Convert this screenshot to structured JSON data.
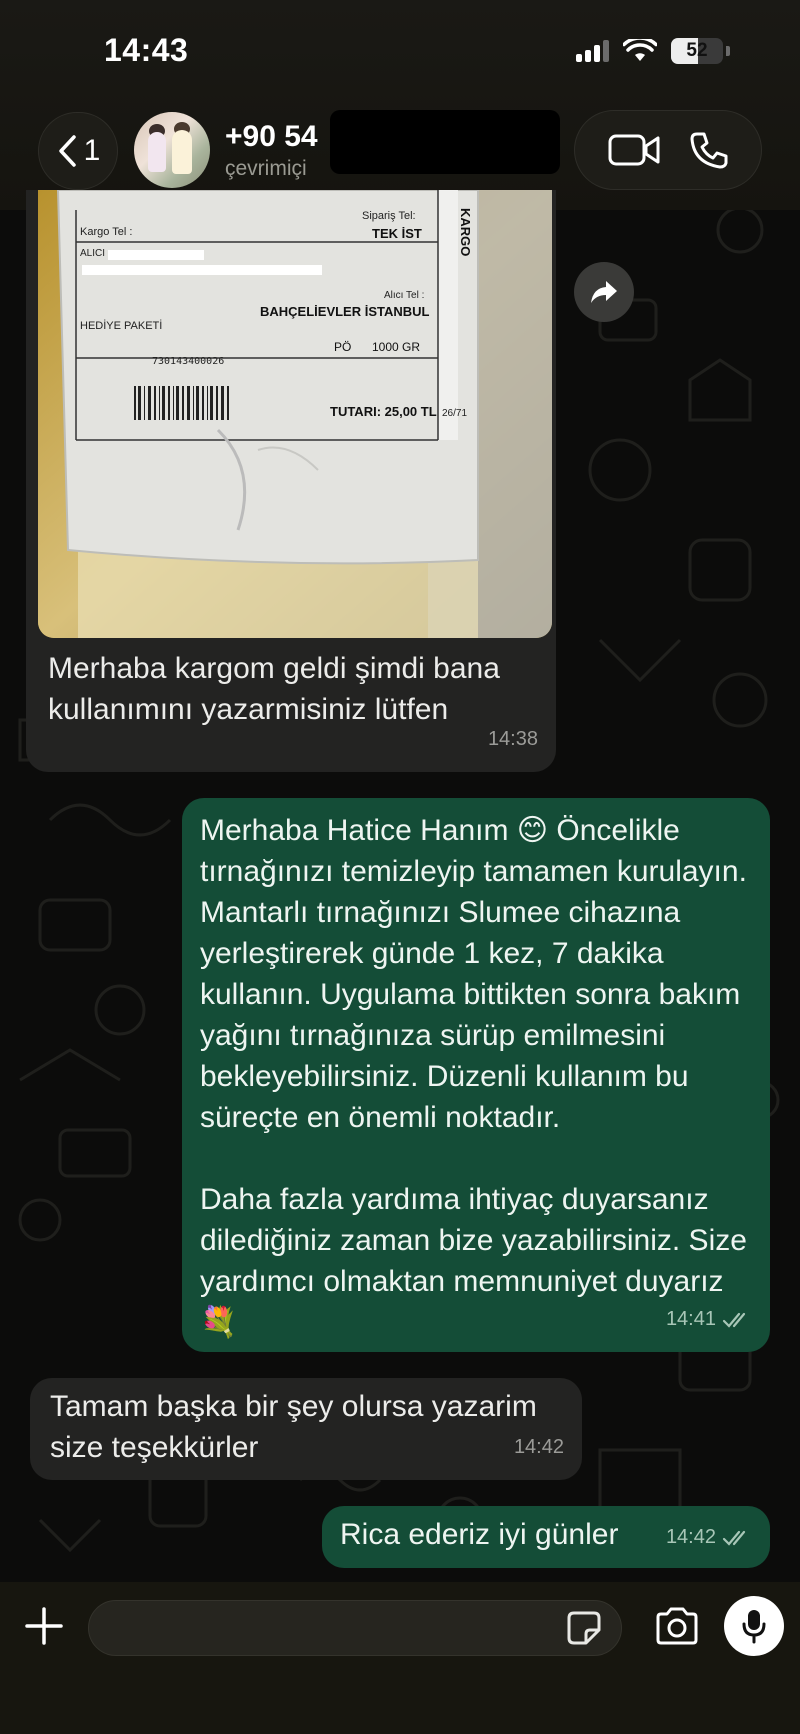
{
  "status_bar": {
    "time": "14:43",
    "battery": "52",
    "battery_level": 0.52
  },
  "header": {
    "back_count": "1",
    "contact_name": "+90 54",
    "contact_status": "çevrimiçi"
  },
  "image_message": {
    "label": {
      "cargo_phone": "Kargo Tel :",
      "order_phone": "Sipariş Tel:",
      "sender_code": "TEK İST",
      "receiver": "ALICI",
      "receiver_phone": "Alıcı Tel :",
      "address": "BAHÇELİEVLER İSTANBUL",
      "package_type": "HEDİYE PAKETİ",
      "weight_code": "PÖ",
      "weight": "1000 GR",
      "barcode": "730143400026",
      "total": "TUTARI: 25,00 TL",
      "side_code": "26/71",
      "brand_side": "KARGO"
    }
  },
  "messages": [
    {
      "direction": "incoming",
      "text": "Merhaba kargom geldi şimdi bana kullanımını yazarmisiniz lütfen",
      "time": "14:38"
    },
    {
      "direction": "outgoing",
      "text": "Merhaba Hatice Hanım 😊 Öncelikle tırnağınızı temizleyip tamamen kurulayın. Mantarlı tırnağınızı Slumee cihazına yerleştirerek günde 1 kez, 7 dakika kullanın. Uygulama bittikten sonra bakım yağını tırnağınıza sürüp emilmesini bekleyebilirsiniz. Düzenli kullanım bu süreçte en önemli noktadır.\n\nDaha fazla yardıma ihtiyaç duyarsanız dilediğiniz zaman bize yazabilirsiniz. Size yardımcı olmaktan memnuniyet duyarız 💐",
      "time": "14:41",
      "read": true
    },
    {
      "direction": "incoming",
      "text": "Tamam başka bir şey olursa yazarim size teşekkürler",
      "time": "14:42"
    },
    {
      "direction": "outgoing",
      "text": "Rica ederiz iyi günler",
      "time": "14:42",
      "read": true
    }
  ],
  "composer": {
    "placeholder": ""
  },
  "icons": {
    "back": "chevron-left-icon",
    "video": "video-camera-icon",
    "call": "phone-icon",
    "forward": "forward-arrow-icon",
    "attach": "plus-icon",
    "sticker": "sticker-icon",
    "camera": "camera-icon",
    "mic": "microphone-icon",
    "read": "double-check-icon"
  },
  "colors": {
    "outgoing_bubble": "#144d37",
    "incoming_bubble": "#232322",
    "read_ticks": "#a8c6b7"
  }
}
